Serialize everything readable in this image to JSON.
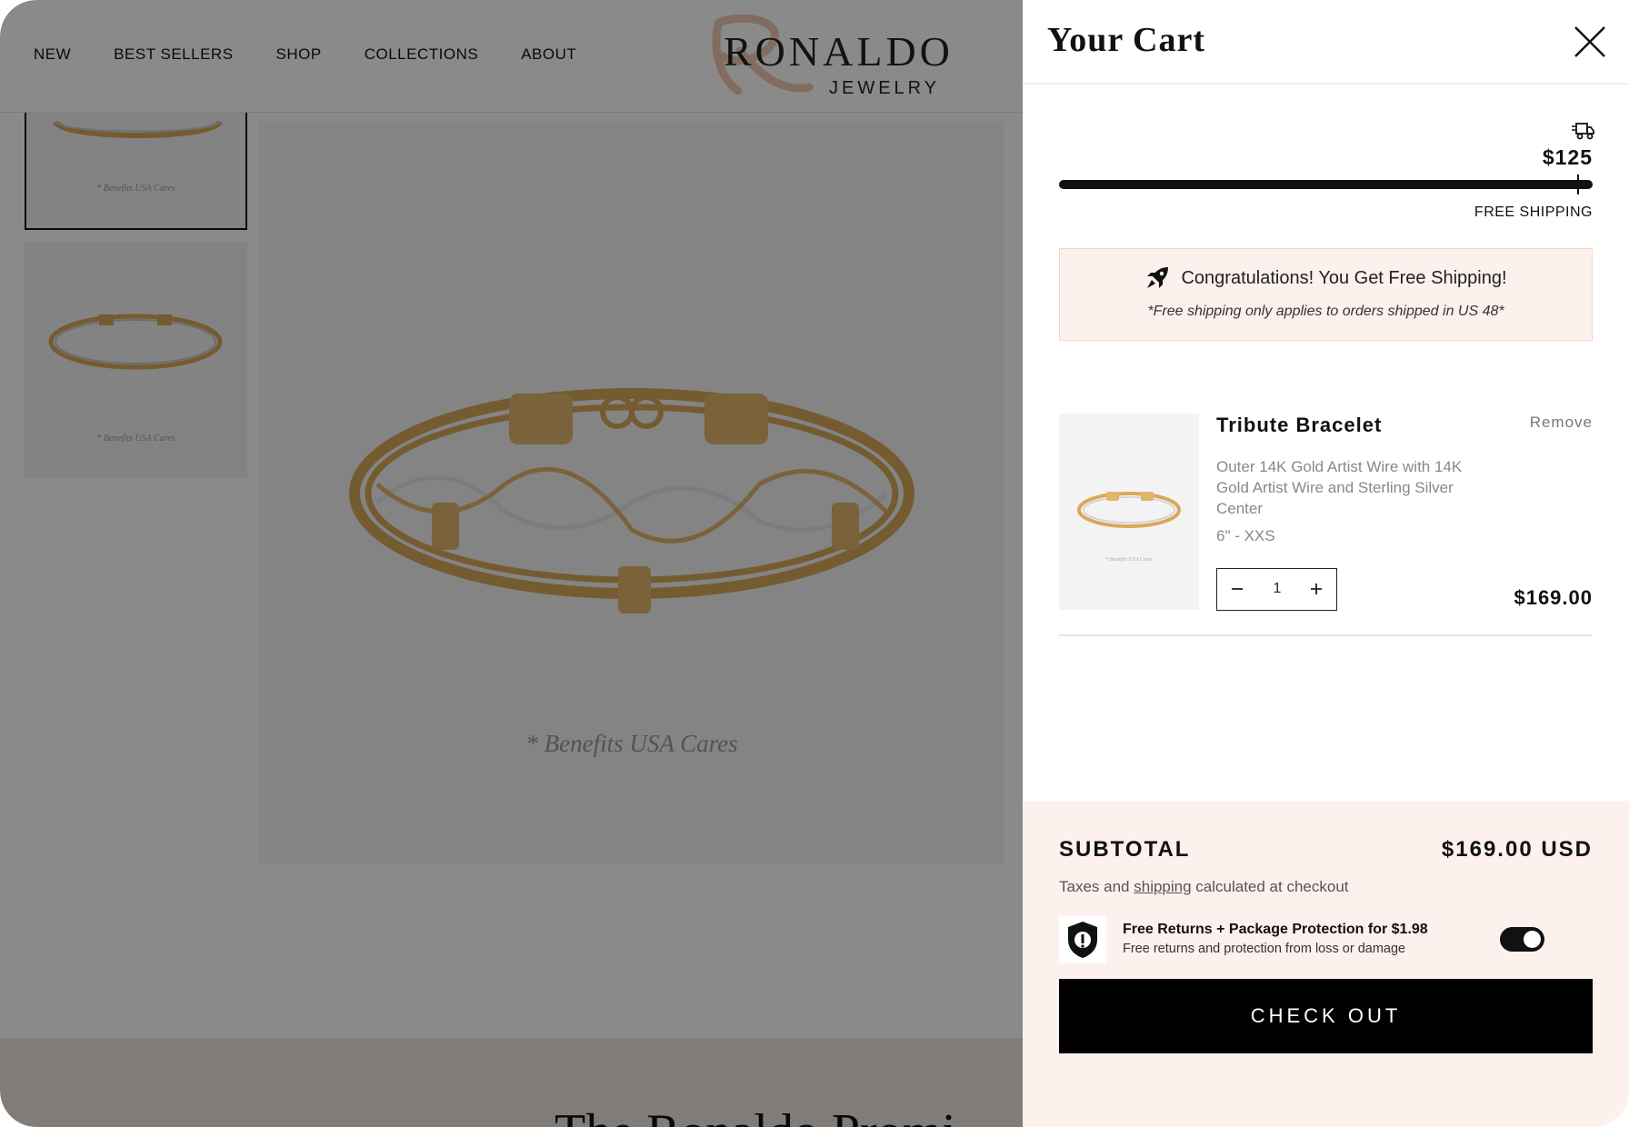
{
  "nav": {
    "items": [
      {
        "label": "NEW"
      },
      {
        "label": "BEST SELLERS"
      },
      {
        "label": "SHOP"
      },
      {
        "label": "COLLECTIONS"
      },
      {
        "label": "ABOUT"
      }
    ]
  },
  "logo": {
    "brand": "RONALDO",
    "sub": "JEWELRY"
  },
  "gallery": {
    "thumb_caption": "* Benefits USA Cares",
    "main_caption": "* Benefits USA Cares"
  },
  "band": {
    "teaser": "The Ronaldo Promi"
  },
  "cart": {
    "title": "Your Cart",
    "shipping": {
      "threshold": "$125",
      "label": "FREE SHIPPING",
      "progress_fraction": 1.0
    },
    "congrats": {
      "message": "Congratulations! You Get Free Shipping!",
      "note": "*Free shipping only applies to orders shipped in US 48*"
    },
    "item": {
      "name": "Tribute Bracelet",
      "remove_label": "Remove",
      "description": "Outer 14K Gold Artist Wire with 14K Gold Artist Wire and Sterling Silver Center",
      "variant": "6\" - XXS",
      "quantity": "1",
      "price": "$169.00",
      "image_caption": "* Benefits USA Cares"
    },
    "footer": {
      "subtotal_label": "SUBTOTAL",
      "subtotal_value": "$169.00 USD",
      "tax_prefix": "Taxes and ",
      "tax_link": "shipping",
      "tax_suffix": " calculated at checkout",
      "protection_title": "Free Returns + Package Protection for $1.98",
      "protection_sub": "Free returns and protection from loss or damage",
      "protection_enabled": true,
      "checkout_label": "CHECK OUT"
    }
  },
  "colors": {
    "accent_pink": "#fdf1ee",
    "gold": "#d9a85a",
    "button_black": "#000000"
  }
}
